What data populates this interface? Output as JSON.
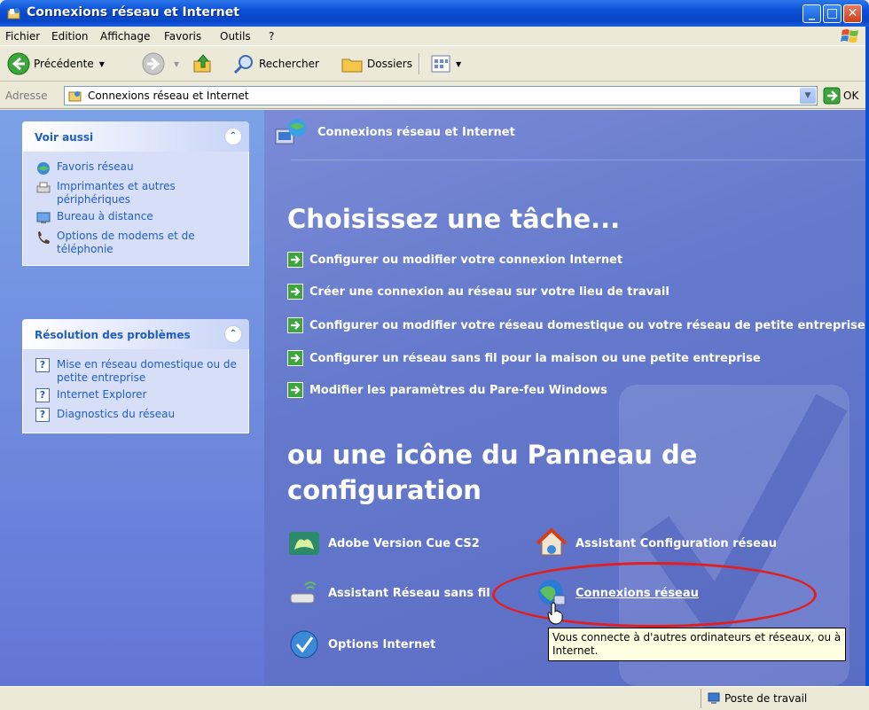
{
  "window": {
    "title": "Connexions réseau et Internet"
  },
  "menu": [
    "Fichier",
    "Edition",
    "Affichage",
    "Favoris",
    "Outils",
    "?"
  ],
  "toolbar": {
    "back_label": "Précédente",
    "search_label": "Rechercher",
    "folders_label": "Dossiers"
  },
  "address": {
    "label": "Adresse",
    "value": "Connexions réseau et Internet",
    "go_label": "OK"
  },
  "see_also": {
    "title": "Voir aussi",
    "items": [
      {
        "label": "Favoris réseau",
        "icon": "network-places-icon"
      },
      {
        "label": "Imprimantes et autres périphériques",
        "icon": "printer-icon"
      },
      {
        "label": "Bureau à distance",
        "icon": "remote-desktop-icon"
      },
      {
        "label": "Options de modems et de téléphonie",
        "icon": "phone-icon"
      }
    ]
  },
  "troubleshoot": {
    "title": "Résolution des problèmes",
    "items": [
      {
        "label": "Mise en réseau domestique ou de petite entreprise",
        "icon": "help-icon"
      },
      {
        "label": "Internet Explorer",
        "icon": "help-icon"
      },
      {
        "label": "Diagnostics du réseau",
        "icon": "help-icon"
      }
    ]
  },
  "main": {
    "header": "Connexions réseau et Internet",
    "task_heading": "Choisissez une tâche...",
    "tasks": [
      "Configurer ou modifier votre connexion Internet",
      "Créer une connexion au réseau sur votre lieu de travail",
      "Configurer ou modifier votre réseau domestique ou votre réseau de petite entreprise",
      "Configurer un réseau sans fil pour la maison ou une petite entreprise",
      "Modifier les paramètres du Pare-feu Windows"
    ],
    "cp_heading_line1": "ou une icône du Panneau de",
    "cp_heading_line2": "configuration",
    "icons": [
      {
        "label": "Adobe Version Cue CS2",
        "icon": "adobe-version-cue-icon"
      },
      {
        "label": "Assistant Configuration réseau",
        "icon": "network-setup-icon"
      },
      {
        "label": "Assistant Réseau sans fil",
        "icon": "wireless-network-icon"
      },
      {
        "label": "Connexions réseau",
        "icon": "network-connections-icon"
      },
      {
        "label": "Options Internet",
        "icon": "internet-options-icon"
      }
    ],
    "tooltip": "Vous connecte à d'autres ordinateurs et réseaux, ou à Internet."
  },
  "status": {
    "zone": "Poste de travail"
  },
  "colors": {
    "title_blue": "#0a4fd6",
    "task_pane": "#6375d6",
    "main_bg": "#6479cc",
    "link_blue": "#215dc6",
    "highlight_red": "#e02020"
  }
}
